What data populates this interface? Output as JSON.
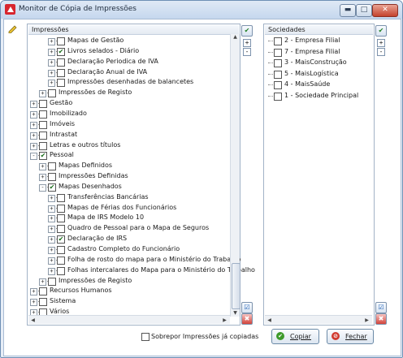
{
  "window": {
    "title": "Monitor de Cópia de Impressões",
    "buttons": [
      "minimize",
      "maximize",
      "close"
    ]
  },
  "left_panel": {
    "header": "Impressões",
    "rows": [
      {
        "label": "Mapas de Gestão",
        "checked": false,
        "expander": "+",
        "level": 3
      },
      {
        "label": "Livros selados - Diário",
        "checked": true,
        "expander": "+",
        "level": 3
      },
      {
        "label": "Declaração Periodica de IVA",
        "checked": false,
        "expander": "+",
        "level": 3
      },
      {
        "label": "Declaração Anual de IVA",
        "checked": false,
        "expander": "+",
        "level": 3
      },
      {
        "label": "Impressões desenhadas de balancetes",
        "checked": false,
        "expander": "+",
        "level": 3
      },
      {
        "label": "Impressões de Registo",
        "checked": false,
        "expander": "+",
        "level": 2
      },
      {
        "label": "Gestão",
        "checked": false,
        "expander": "+",
        "level": 1
      },
      {
        "label": "Imobilizado",
        "checked": false,
        "expander": "+",
        "level": 1
      },
      {
        "label": "Imóveis",
        "checked": false,
        "expander": "+",
        "level": 1
      },
      {
        "label": "Intrastat",
        "checked": false,
        "expander": "+",
        "level": 1
      },
      {
        "label": "Letras e outros títulos",
        "checked": false,
        "expander": "+",
        "level": 1
      },
      {
        "label": "Pessoal",
        "checked": true,
        "expander": "-",
        "level": 1
      },
      {
        "label": "Mapas Definidos",
        "checked": false,
        "expander": "+",
        "level": 2
      },
      {
        "label": "Impressões Definidas",
        "checked": false,
        "expander": "+",
        "level": 2
      },
      {
        "label": "Mapas Desenhados",
        "checked": true,
        "expander": "-",
        "level": 2
      },
      {
        "label": "Transferências Bancárias",
        "checked": false,
        "expander": "+",
        "level": 3
      },
      {
        "label": "Mapas de Férias dos Funcionários",
        "checked": false,
        "expander": "+",
        "level": 3
      },
      {
        "label": "Mapa de IRS Modelo 10",
        "checked": false,
        "expander": "+",
        "level": 3
      },
      {
        "label": "Quadro de Pessoal para o Mapa de Seguros",
        "checked": false,
        "expander": "+",
        "level": 3
      },
      {
        "label": "Declaração de IRS",
        "checked": true,
        "expander": "+",
        "level": 3
      },
      {
        "label": "Cadastro Completo do Funcionário",
        "checked": false,
        "expander": "+",
        "level": 3
      },
      {
        "label": "Folha de rosto do mapa para o Ministério do Trabalho",
        "checked": false,
        "expander": "+",
        "level": 3
      },
      {
        "label": "Folhas intercalares do Mapa para o Ministério do Trabalho",
        "checked": false,
        "expander": "+",
        "level": 3
      },
      {
        "label": "Impressões de Registo",
        "checked": false,
        "expander": "+",
        "level": 2
      },
      {
        "label": "Recursos Humanos",
        "checked": false,
        "expander": "+",
        "level": 1
      },
      {
        "label": "Sistema",
        "checked": false,
        "expander": "+",
        "level": 1
      },
      {
        "label": "Vários",
        "checked": false,
        "expander": "+",
        "level": 1
      }
    ]
  },
  "right_panel": {
    "header": "Sociedades",
    "rows": [
      {
        "label": "2 - Empresa Filial",
        "checked": false
      },
      {
        "label": "7 - Empresa Filial",
        "checked": false
      },
      {
        "label": "3 - MaisConstrução",
        "checked": false
      },
      {
        "label": "5 - MaisLogística",
        "checked": false
      },
      {
        "label": "4 - MaisSaúde",
        "checked": false
      },
      {
        "label": "1 - Sociedade Principal",
        "checked": false
      }
    ]
  },
  "side_tools": {
    "expand_all": "+",
    "collapse_all": "-"
  },
  "footer": {
    "overwrite_label": "Sobrepor Impressões já copiadas",
    "overwrite_checked": false,
    "copy_label": "Copiar",
    "close_label": "Fechar"
  },
  "colors": {
    "title_bg": "#c5d7ee",
    "accent_green": "#1f7e23",
    "accent_red": "#d3433a"
  }
}
